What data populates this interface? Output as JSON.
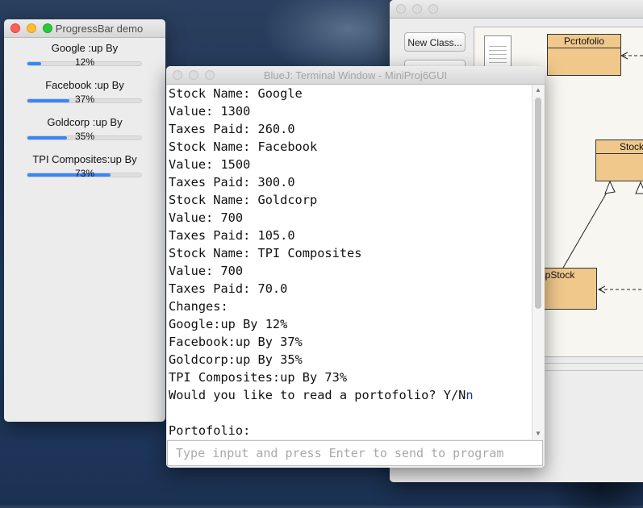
{
  "progress_window": {
    "title": "ProgressBar demo",
    "bars": [
      {
        "label": "Google :up By",
        "percent_text": "12%",
        "value": 0.12
      },
      {
        "label": "Facebook :up By",
        "percent_text": "37%",
        "value": 0.37
      },
      {
        "label": "Goldcorp :up By",
        "percent_text": "35%",
        "value": 0.35
      },
      {
        "label": "TPI Composites:up By",
        "percent_text": "73%",
        "value": 0.73
      }
    ],
    "accent_color": "#3b86f6"
  },
  "terminal_window": {
    "title": "BlueJ: Terminal Window - MiniProj6GUI",
    "lines": [
      "Stock Name: Google",
      "Value: 1300",
      "Taxes Paid: 260.0",
      "Stock Name: Facebook",
      "Value: 1500",
      "Taxes Paid: 300.0",
      "Stock Name: Goldcorp",
      "Value: 700",
      "Taxes Paid: 105.0",
      "Stock Name: TPI Composites",
      "Value: 700",
      "Taxes Paid: 70.0",
      "Changes:",
      "Google:up By 12%",
      "Facebook:up By 37%",
      "Goldcorp:up By 35%",
      "TPI Composites:up By 73%",
      "Would you like to read a portofolio? Y/N",
      "",
      "Portofolio:"
    ],
    "user_echo": "n",
    "input_placeholder": "Type input and press Enter to send to program"
  },
  "bluej_main": {
    "new_class_label": "New Class...",
    "classes": [
      {
        "name": "Pcrtofolio"
      },
      {
        "name": "Stock"
      },
      {
        "name": "apStock"
      }
    ],
    "class_color": "#f0c88c"
  }
}
